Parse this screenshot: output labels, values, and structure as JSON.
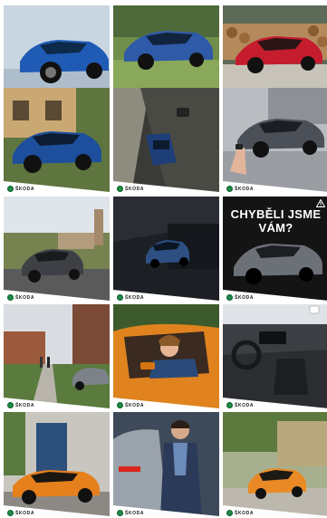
{
  "brand_text": "ŠKODA",
  "tiles": [
    {
      "id": "blue-suv-studio",
      "headline": ""
    },
    {
      "id": "blue-suv-garden",
      "headline": ""
    },
    {
      "id": "red-suv-logs",
      "headline": ""
    },
    {
      "id": "blue-suv-house",
      "headline": ""
    },
    {
      "id": "car-tunnel-aerial",
      "headline": ""
    },
    {
      "id": "grey-suv-key",
      "headline": ""
    },
    {
      "id": "suv-castle-road",
      "headline": ""
    },
    {
      "id": "suv-dark-garage",
      "headline": ""
    },
    {
      "id": "promo-missed-us",
      "headline": "CHYBĚLI JSME VÁM?"
    },
    {
      "id": "street-walkers",
      "headline": ""
    },
    {
      "id": "woman-orange-car",
      "headline": ""
    },
    {
      "id": "car-interior-dashboard",
      "headline": ""
    },
    {
      "id": "orange-car-blue-door",
      "headline": ""
    },
    {
      "id": "man-grey-car",
      "headline": ""
    },
    {
      "id": "orange-car-street",
      "headline": ""
    }
  ],
  "colors": {
    "brand_green": "#1c8c46",
    "banner_white": "#ffffff"
  }
}
